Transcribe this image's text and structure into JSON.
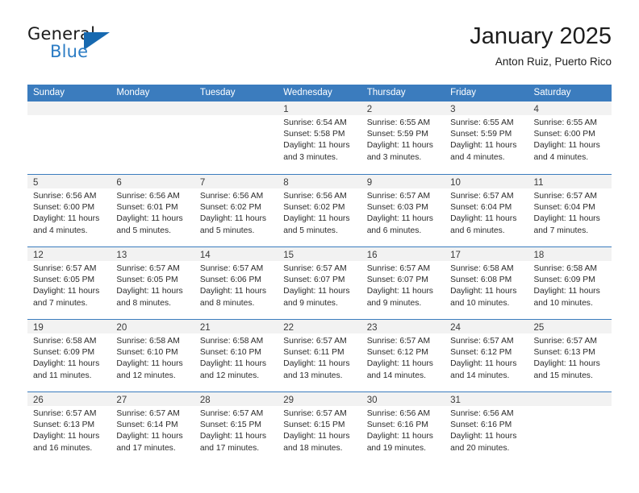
{
  "logo": {
    "word_top": "General",
    "word_bottom": "Blue",
    "triangle_color": "#1769b0",
    "blue_text_color": "#2b7cc4"
  },
  "header": {
    "title": "January 2025",
    "subtitle": "Anton Ruiz, Puerto Rico"
  },
  "theme": {
    "header_blue": "#3b7cbe",
    "day_head_gray": "#f2f2f2",
    "text_color": "#2b2b2b"
  },
  "weekdays": [
    "Sunday",
    "Monday",
    "Tuesday",
    "Wednesday",
    "Thursday",
    "Friday",
    "Saturday"
  ],
  "weeks": [
    [
      {
        "num": "",
        "lines": [
          "",
          "",
          "",
          ""
        ],
        "empty": true
      },
      {
        "num": "",
        "lines": [
          "",
          "",
          "",
          ""
        ],
        "empty": true
      },
      {
        "num": "",
        "lines": [
          "",
          "",
          "",
          ""
        ],
        "empty": true
      },
      {
        "num": "1",
        "lines": [
          "Sunrise: 6:54 AM",
          "Sunset: 5:58 PM",
          "Daylight: 11 hours",
          "and 3 minutes."
        ]
      },
      {
        "num": "2",
        "lines": [
          "Sunrise: 6:55 AM",
          "Sunset: 5:59 PM",
          "Daylight: 11 hours",
          "and 3 minutes."
        ]
      },
      {
        "num": "3",
        "lines": [
          "Sunrise: 6:55 AM",
          "Sunset: 5:59 PM",
          "Daylight: 11 hours",
          "and 4 minutes."
        ]
      },
      {
        "num": "4",
        "lines": [
          "Sunrise: 6:55 AM",
          "Sunset: 6:00 PM",
          "Daylight: 11 hours",
          "and 4 minutes."
        ]
      }
    ],
    [
      {
        "num": "5",
        "lines": [
          "Sunrise: 6:56 AM",
          "Sunset: 6:00 PM",
          "Daylight: 11 hours",
          "and 4 minutes."
        ]
      },
      {
        "num": "6",
        "lines": [
          "Sunrise: 6:56 AM",
          "Sunset: 6:01 PM",
          "Daylight: 11 hours",
          "and 5 minutes."
        ]
      },
      {
        "num": "7",
        "lines": [
          "Sunrise: 6:56 AM",
          "Sunset: 6:02 PM",
          "Daylight: 11 hours",
          "and 5 minutes."
        ]
      },
      {
        "num": "8",
        "lines": [
          "Sunrise: 6:56 AM",
          "Sunset: 6:02 PM",
          "Daylight: 11 hours",
          "and 5 minutes."
        ]
      },
      {
        "num": "9",
        "lines": [
          "Sunrise: 6:57 AM",
          "Sunset: 6:03 PM",
          "Daylight: 11 hours",
          "and 6 minutes."
        ]
      },
      {
        "num": "10",
        "lines": [
          "Sunrise: 6:57 AM",
          "Sunset: 6:04 PM",
          "Daylight: 11 hours",
          "and 6 minutes."
        ]
      },
      {
        "num": "11",
        "lines": [
          "Sunrise: 6:57 AM",
          "Sunset: 6:04 PM",
          "Daylight: 11 hours",
          "and 7 minutes."
        ]
      }
    ],
    [
      {
        "num": "12",
        "lines": [
          "Sunrise: 6:57 AM",
          "Sunset: 6:05 PM",
          "Daylight: 11 hours",
          "and 7 minutes."
        ]
      },
      {
        "num": "13",
        "lines": [
          "Sunrise: 6:57 AM",
          "Sunset: 6:05 PM",
          "Daylight: 11 hours",
          "and 8 minutes."
        ]
      },
      {
        "num": "14",
        "lines": [
          "Sunrise: 6:57 AM",
          "Sunset: 6:06 PM",
          "Daylight: 11 hours",
          "and 8 minutes."
        ]
      },
      {
        "num": "15",
        "lines": [
          "Sunrise: 6:57 AM",
          "Sunset: 6:07 PM",
          "Daylight: 11 hours",
          "and 9 minutes."
        ]
      },
      {
        "num": "16",
        "lines": [
          "Sunrise: 6:57 AM",
          "Sunset: 6:07 PM",
          "Daylight: 11 hours",
          "and 9 minutes."
        ]
      },
      {
        "num": "17",
        "lines": [
          "Sunrise: 6:58 AM",
          "Sunset: 6:08 PM",
          "Daylight: 11 hours",
          "and 10 minutes."
        ]
      },
      {
        "num": "18",
        "lines": [
          "Sunrise: 6:58 AM",
          "Sunset: 6:09 PM",
          "Daylight: 11 hours",
          "and 10 minutes."
        ]
      }
    ],
    [
      {
        "num": "19",
        "lines": [
          "Sunrise: 6:58 AM",
          "Sunset: 6:09 PM",
          "Daylight: 11 hours",
          "and 11 minutes."
        ]
      },
      {
        "num": "20",
        "lines": [
          "Sunrise: 6:58 AM",
          "Sunset: 6:10 PM",
          "Daylight: 11 hours",
          "and 12 minutes."
        ]
      },
      {
        "num": "21",
        "lines": [
          "Sunrise: 6:58 AM",
          "Sunset: 6:10 PM",
          "Daylight: 11 hours",
          "and 12 minutes."
        ]
      },
      {
        "num": "22",
        "lines": [
          "Sunrise: 6:57 AM",
          "Sunset: 6:11 PM",
          "Daylight: 11 hours",
          "and 13 minutes."
        ]
      },
      {
        "num": "23",
        "lines": [
          "Sunrise: 6:57 AM",
          "Sunset: 6:12 PM",
          "Daylight: 11 hours",
          "and 14 minutes."
        ]
      },
      {
        "num": "24",
        "lines": [
          "Sunrise: 6:57 AM",
          "Sunset: 6:12 PM",
          "Daylight: 11 hours",
          "and 14 minutes."
        ]
      },
      {
        "num": "25",
        "lines": [
          "Sunrise: 6:57 AM",
          "Sunset: 6:13 PM",
          "Daylight: 11 hours",
          "and 15 minutes."
        ]
      }
    ],
    [
      {
        "num": "26",
        "lines": [
          "Sunrise: 6:57 AM",
          "Sunset: 6:13 PM",
          "Daylight: 11 hours",
          "and 16 minutes."
        ]
      },
      {
        "num": "27",
        "lines": [
          "Sunrise: 6:57 AM",
          "Sunset: 6:14 PM",
          "Daylight: 11 hours",
          "and 17 minutes."
        ]
      },
      {
        "num": "28",
        "lines": [
          "Sunrise: 6:57 AM",
          "Sunset: 6:15 PM",
          "Daylight: 11 hours",
          "and 17 minutes."
        ]
      },
      {
        "num": "29",
        "lines": [
          "Sunrise: 6:57 AM",
          "Sunset: 6:15 PM",
          "Daylight: 11 hours",
          "and 18 minutes."
        ]
      },
      {
        "num": "30",
        "lines": [
          "Sunrise: 6:56 AM",
          "Sunset: 6:16 PM",
          "Daylight: 11 hours",
          "and 19 minutes."
        ]
      },
      {
        "num": "31",
        "lines": [
          "Sunrise: 6:56 AM",
          "Sunset: 6:16 PM",
          "Daylight: 11 hours",
          "and 20 minutes."
        ]
      },
      {
        "num": "",
        "lines": [
          "",
          "",
          "",
          ""
        ],
        "empty": true
      }
    ]
  ]
}
